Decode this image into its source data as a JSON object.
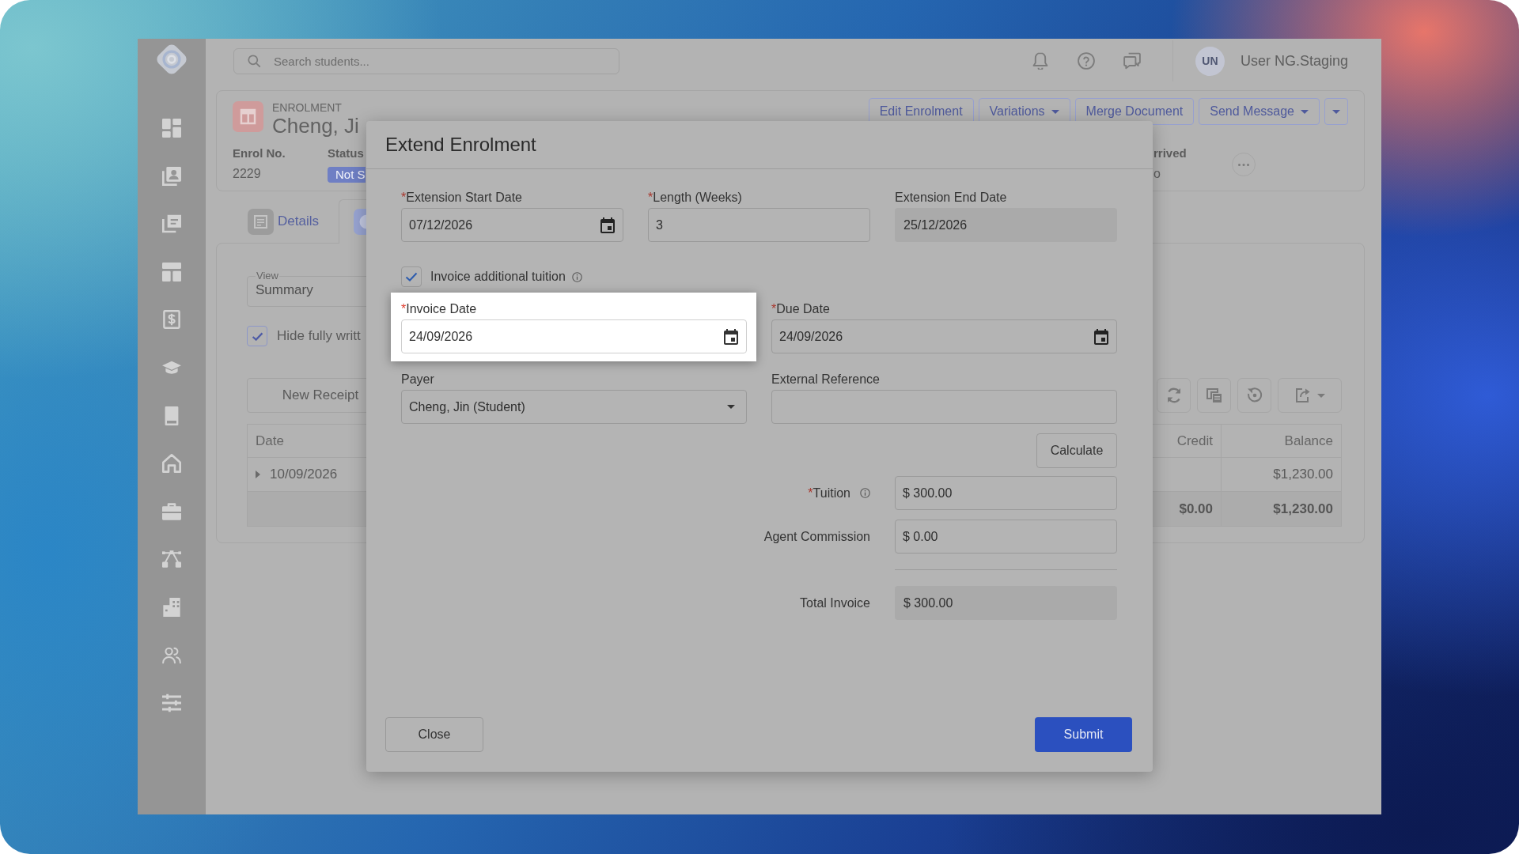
{
  "app": {
    "topbar": {
      "search": {
        "placeholder": "Search students..."
      },
      "user": {
        "initials": "UN",
        "name": "User NG.Staging"
      }
    },
    "header": {
      "caption": "ENROLMENT",
      "title": "Cheng, Ji",
      "fields": [
        {
          "kind": "text",
          "label": "Enrol No.",
          "value": "2229"
        },
        {
          "kind": "badge",
          "label": "Status",
          "value": "Not S"
        }
      ],
      "actions": [
        {
          "label": "Edit Enrolment",
          "dropdown": false
        },
        {
          "label": "Variations",
          "dropdown": true
        },
        {
          "label": "Merge Document",
          "dropdown": false
        },
        {
          "label": "Send Message",
          "dropdown": true
        },
        {
          "dropdown": true
        }
      ],
      "arrived": {
        "label": "rrived",
        "value": "o"
      }
    },
    "tabs": [
      {
        "label": "Details",
        "selected": false
      },
      {
        "selected": true
      }
    ],
    "transactions": {
      "view": {
        "label": "View",
        "value": "Summary"
      },
      "filter": {
        "label": "Hide fully writt",
        "checked": true
      },
      "new_button": "New Receipt",
      "table": {
        "columns": [
          "Date",
          "Credit",
          "Balance"
        ],
        "rows": [
          {
            "kind": "entry",
            "expanded": false,
            "date": "10/09/2026",
            "balance": "$1,230.00"
          },
          {
            "kind": "total",
            "credit": "$0.00",
            "balance": "$1,230.00"
          }
        ]
      }
    }
  },
  "dialog": {
    "title": "Extend Enrolment",
    "period": [
      {
        "marker": "*",
        "label": "Extension Start Date",
        "kind": "date",
        "value": "07/12/2026"
      },
      {
        "marker": "*",
        "label": "Length (Weeks)",
        "kind": "text",
        "value": "3"
      },
      {
        "label": "Extension End Date",
        "kind": "readonly",
        "value": "25/12/2026"
      }
    ],
    "invoice_toggle": {
      "label": "Invoice additional tuition",
      "checked": true,
      "info": true
    },
    "invoice": [
      {
        "marker": "*",
        "label": "Invoice Date",
        "kind": "date",
        "value": "24/09/2026",
        "highlighted": true
      },
      {
        "marker": "*",
        "label": "Due Date",
        "kind": "date",
        "value": "24/09/2026",
        "highlighted": false
      },
      {
        "label": "Payer",
        "kind": "select",
        "value": "Cheng, Jin (Student)",
        "highlighted": false
      },
      {
        "label": "External Reference",
        "kind": "text",
        "highlighted": false
      }
    ],
    "calculate_button": "Calculate",
    "amounts": [
      {
        "marker": "*",
        "label": "Tuition",
        "info": true,
        "kind": "input",
        "value": "$ 300.00"
      },
      {
        "label": "Agent Commission",
        "info": false,
        "kind": "input",
        "value": "$ 0.00"
      }
    ],
    "total": {
      "label": "Total Invoice",
      "value": "$ 300.00"
    },
    "buttons": [
      {
        "kind": "secondary",
        "label": "Close"
      },
      {
        "kind": "primary",
        "label": "Submit"
      }
    ]
  }
}
